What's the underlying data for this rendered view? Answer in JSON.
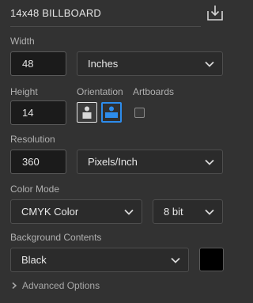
{
  "preset": {
    "name": "14x48 BILLBOARD",
    "save_icon": "save-preset-icon"
  },
  "width": {
    "label": "Width",
    "value": "48",
    "unit": "Inches"
  },
  "height": {
    "label": "Height",
    "value": "14"
  },
  "orientation": {
    "label": "Orientation",
    "selected": "landscape",
    "options": [
      "portrait",
      "landscape"
    ]
  },
  "artboards": {
    "label": "Artboards",
    "checked": false
  },
  "resolution": {
    "label": "Resolution",
    "value": "360",
    "unit": "Pixels/Inch"
  },
  "color_mode": {
    "label": "Color Mode",
    "mode": "CMYK Color",
    "depth": "8 bit"
  },
  "background": {
    "label": "Background Contents",
    "value": "Black",
    "swatch_color": "#000000"
  },
  "advanced": {
    "label": "Advanced Options"
  },
  "colors": {
    "panel_bg": "#323232",
    "accent": "#2d8ceb"
  }
}
